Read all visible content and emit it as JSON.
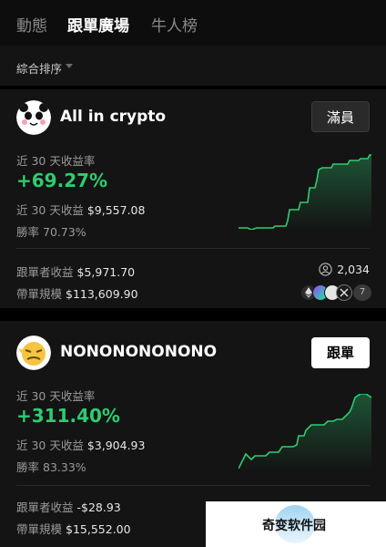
{
  "nav": {
    "tabs": [
      {
        "label": "動態",
        "active": false
      },
      {
        "label": "跟單廣場",
        "active": true
      },
      {
        "label": "牛人榜",
        "active": false
      }
    ]
  },
  "sort": {
    "label": "綜合排序"
  },
  "traders": [
    {
      "name": "All in crypto",
      "button": "滿員",
      "roi_label": "近 30 天收益率",
      "roi": "+69.27%",
      "pnl_label": "近 30 天收益",
      "pnl": "$9,557.08",
      "winrate_label": "勝率",
      "winrate": "70.73%",
      "follower_pnl_label": "跟單者收益",
      "follower_pnl": "$5,971.70",
      "aum_label": "帶單規模",
      "aum": "$113,609.90",
      "followers": "2,034",
      "coins_more": "7"
    },
    {
      "name": "NONONONONONO",
      "button": "跟單",
      "roi_label": "近 30 天收益率",
      "roi": "+311.40%",
      "pnl_label": "近 30 天收益",
      "pnl": "$3,904.93",
      "winrate_label": "勝率",
      "winrate": "83.33%",
      "follower_pnl_label": "跟單者收益",
      "follower_pnl": "-$28.93",
      "aum_label": "帶單規模",
      "aum": "$15,552.00"
    }
  ],
  "watermark": {
    "text": "奇变软件园"
  },
  "colors": {
    "positive": "#2ecc71",
    "background": "#000000",
    "card": "#141414"
  }
}
